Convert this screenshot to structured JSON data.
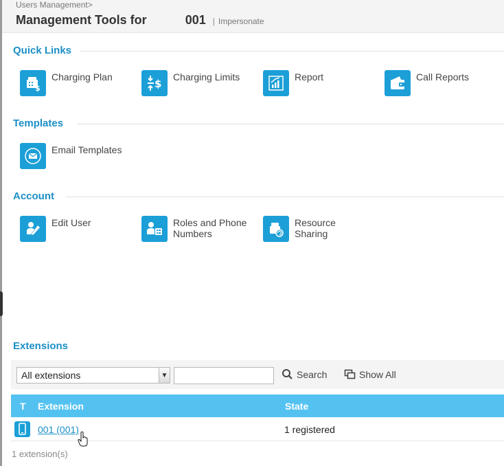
{
  "header": {
    "breadcrumb": "Users Management>",
    "title": "Management Tools for",
    "user_id": "001",
    "separator": "|",
    "impersonate": "Impersonate"
  },
  "sections": {
    "quick_links": {
      "title": "Quick Links",
      "items": [
        {
          "label": "Charging Plan",
          "icon": "charging-plan-icon"
        },
        {
          "label": "Charging Limits",
          "icon": "charging-limits-icon"
        },
        {
          "label": "Report",
          "icon": "report-icon"
        },
        {
          "label": "Call Reports",
          "icon": "call-reports-icon"
        }
      ]
    },
    "templates": {
      "title": "Templates",
      "items": [
        {
          "label": "Email Templates",
          "icon": "envelope-icon"
        }
      ]
    },
    "account": {
      "title": "Account",
      "items": [
        {
          "label": "Edit User",
          "icon": "edit-user-icon"
        },
        {
          "label": "Roles and Phone Numbers",
          "icon": "roles-icon"
        },
        {
          "label": "Resource Sharing",
          "icon": "resource-sharing-icon"
        }
      ]
    }
  },
  "extensions": {
    "title": "Extensions",
    "filter": {
      "selected": "All extensions",
      "search_value": "",
      "search_label": "Search",
      "show_all_label": "Show All"
    },
    "columns": {
      "type": "T",
      "extension": "Extension",
      "state": "State"
    },
    "rows": [
      {
        "extension": "001 (001)",
        "state": "1 registered",
        "type_icon": "phone-icon"
      }
    ],
    "count": "1 extension(s)"
  },
  "colors": {
    "accent": "#1b8fc6",
    "icon_bg": "#1c9fd7",
    "table_header": "#54c2f1"
  }
}
